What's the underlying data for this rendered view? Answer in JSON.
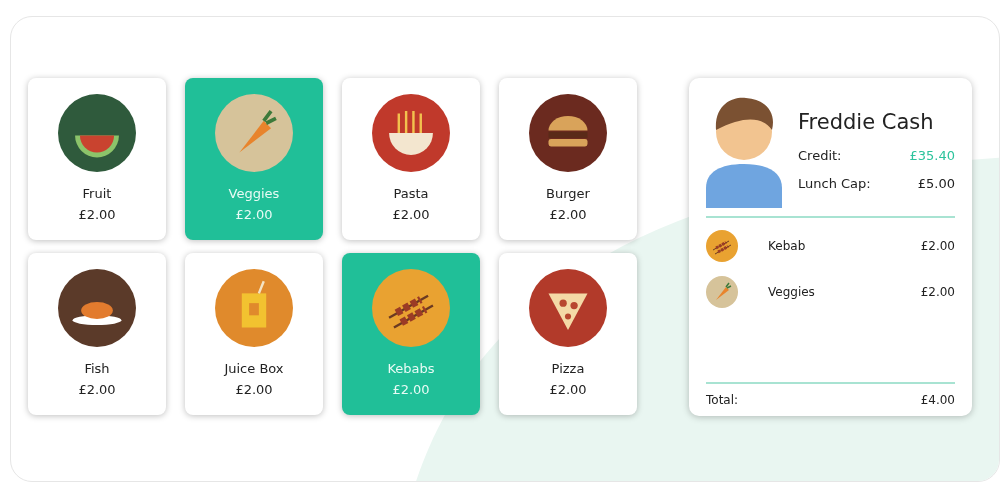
{
  "products": [
    {
      "name": "Fruit",
      "price": "£2.00",
      "kind": "watermelon",
      "selected": false
    },
    {
      "name": "Veggies",
      "price": "£2.00",
      "kind": "carrot",
      "selected": true
    },
    {
      "name": "Pasta",
      "price": "£2.00",
      "kind": "noodles",
      "selected": false
    },
    {
      "name": "Burger",
      "price": "£2.00",
      "kind": "burger",
      "selected": false
    },
    {
      "name": "Fish",
      "price": "£2.00",
      "kind": "fish",
      "selected": false
    },
    {
      "name": "Juice Box",
      "price": "£2.00",
      "kind": "juice",
      "selected": false
    },
    {
      "name": "Kebabs",
      "price": "£2.00",
      "kind": "kebab",
      "selected": true
    },
    {
      "name": "Pizza",
      "price": "£2.00",
      "kind": "pizza",
      "selected": false
    }
  ],
  "customer": {
    "name": "Freddie Cash",
    "credit_label": "Credit:",
    "credit": "£35.40",
    "cap_label": "Lunch Cap:",
    "cap": "£5.00"
  },
  "order": [
    {
      "name": "Kebab",
      "price": "£2.00",
      "kind": "kebab"
    },
    {
      "name": "Veggies",
      "price": "£2.00",
      "kind": "carrot"
    }
  ],
  "total": {
    "label": "Total:",
    "value": "£4.00"
  }
}
